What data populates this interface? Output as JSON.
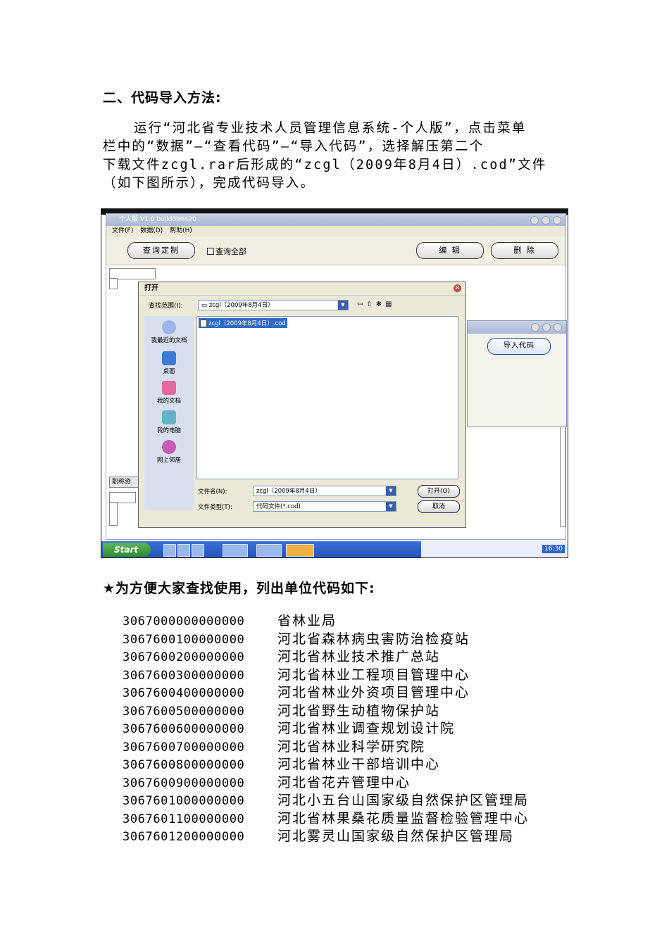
{
  "heading": "二、代码导入方法:",
  "paragraph_lines": [
    "运行“河北省专业技术人员管理信息系统-个人版”，点击菜单",
    "栏中的“数据”—“查看代码”—“导入代码”，选择解压第二个",
    "下载文件zcgl.rar后形成的“zcgl（2009年8月4日）.cod”文件",
    "（如下图所示），完成代码导入。"
  ],
  "screenshot": {
    "app_title": "个人版 V1.0 build090420",
    "menu": [
      "文件(F)",
      "数据(D)",
      "帮助(H)"
    ],
    "toolbar": {
      "query_button": "查询定制",
      "query_all_label": "查询全部",
      "edit_button": "编 辑",
      "delete_button": "删 除"
    },
    "tab_label": "职称资",
    "import_button": "导入代码",
    "dialog": {
      "title": "打开",
      "look_in_label": "查找范围(I):",
      "look_in_value": "zcgl（2009年8月4日）",
      "places": [
        "我最近的文档",
        "桌面",
        "我的文档",
        "我的电脑",
        "网上邻居"
      ],
      "file_item": "zcgl（2009年8月4日）.cod",
      "filename_label": "文件名(N):",
      "filename_value": "zcgl（2009年8月4日）",
      "filetype_label": "文件类型(T):",
      "filetype_value": "代码文件(*.cod)",
      "open_button": "打开(O)",
      "cancel_button": "取消"
    },
    "taskbar": {
      "start_label": "Start",
      "clock": "16:30"
    }
  },
  "list_heading": "★为方便大家查找使用，列出单位代码如下:",
  "codes": [
    {
      "code": "3067000000000000",
      "name": "省林业局"
    },
    {
      "code": "3067600100000000",
      "name": "河北省森林病虫害防治检疫站"
    },
    {
      "code": "3067600200000000",
      "name": "河北省林业技术推广总站"
    },
    {
      "code": "3067600300000000",
      "name": "河北省林业工程项目管理中心"
    },
    {
      "code": "3067600400000000",
      "name": "河北省林业外资项目管理中心"
    },
    {
      "code": "3067600500000000",
      "name": "河北省野生动植物保护站"
    },
    {
      "code": "3067600600000000",
      "name": "河北省林业调查规划设计院"
    },
    {
      "code": "3067600700000000",
      "name": "河北省林业科学研究院"
    },
    {
      "code": "3067600800000000",
      "name": "河北省林业干部培训中心"
    },
    {
      "code": "3067600900000000",
      "name": "河北省花卉管理中心"
    },
    {
      "code": "3067601000000000",
      "name": "河北小五台山国家级自然保护区管理局"
    },
    {
      "code": "3067601100000000",
      "name": "河北省林果桑花质量监督检验管理中心"
    },
    {
      "code": "3067601200000000",
      "name": "河北雾灵山国家级自然保护区管理局"
    }
  ]
}
